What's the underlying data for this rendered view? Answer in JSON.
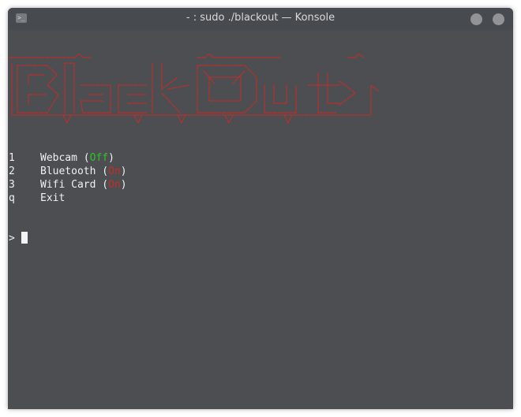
{
  "window": {
    "title": "- : sudo ./blackout — Konsole",
    "icon": "terminal-icon"
  },
  "banner": {
    "text": "Blackout",
    "color": "#c0302b"
  },
  "menu": {
    "items": [
      {
        "key": "1",
        "label": "Webcam",
        "status": "Off",
        "status_color": "#2cc52c"
      },
      {
        "key": "2",
        "label": "Bluetooth",
        "status": "On",
        "status_color": "#c0302b"
      },
      {
        "key": "3",
        "label": "Wifi Card",
        "status": "On",
        "status_color": "#c0302b"
      },
      {
        "key": "q",
        "label": "Exit"
      }
    ]
  },
  "prompt": {
    "symbol": ">"
  },
  "colors": {
    "terminal_bg": "#4d4e51",
    "titlebar_bg": "#474a4e",
    "text": "#eff0f1"
  }
}
